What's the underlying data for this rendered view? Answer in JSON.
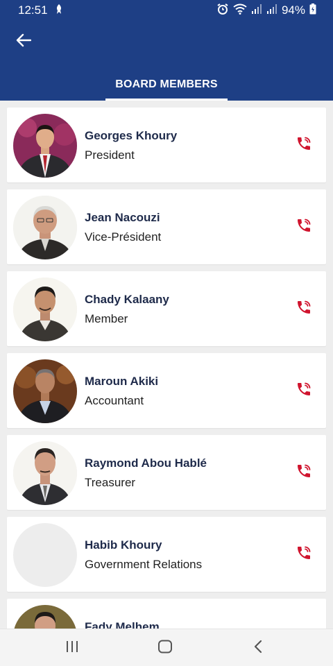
{
  "status_bar": {
    "time": "12:51",
    "battery": "94%"
  },
  "app_bar": {
    "back_icon": "arrow-left-icon",
    "tab_label": "BOARD MEMBERS"
  },
  "members": [
    {
      "name": "Georges Khoury",
      "role": "President",
      "has_photo": true
    },
    {
      "name": "Jean Nacouzi",
      "role": "Vice-Président",
      "has_photo": true
    },
    {
      "name": "Chady Kalaany",
      "role": "Member",
      "has_photo": true
    },
    {
      "name": "Maroun Akiki",
      "role": "Accountant",
      "has_photo": true
    },
    {
      "name": "Raymond Abou Hablé",
      "role": "Treasurer",
      "has_photo": true
    },
    {
      "name": "Habib Khoury",
      "role": "Government Relations",
      "has_photo": false
    },
    {
      "name": "Fady Melhem",
      "role": "",
      "has_photo": true
    }
  ],
  "colors": {
    "primary": "#1e3f85",
    "call_icon": "#d0142e",
    "name_text": "#1e2a4a",
    "background": "#eeeeee"
  },
  "icons": {
    "call": "phone-ringing-icon",
    "nav_recents": "recents-icon",
    "nav_home": "home-icon",
    "nav_back": "back-chevron-icon"
  }
}
